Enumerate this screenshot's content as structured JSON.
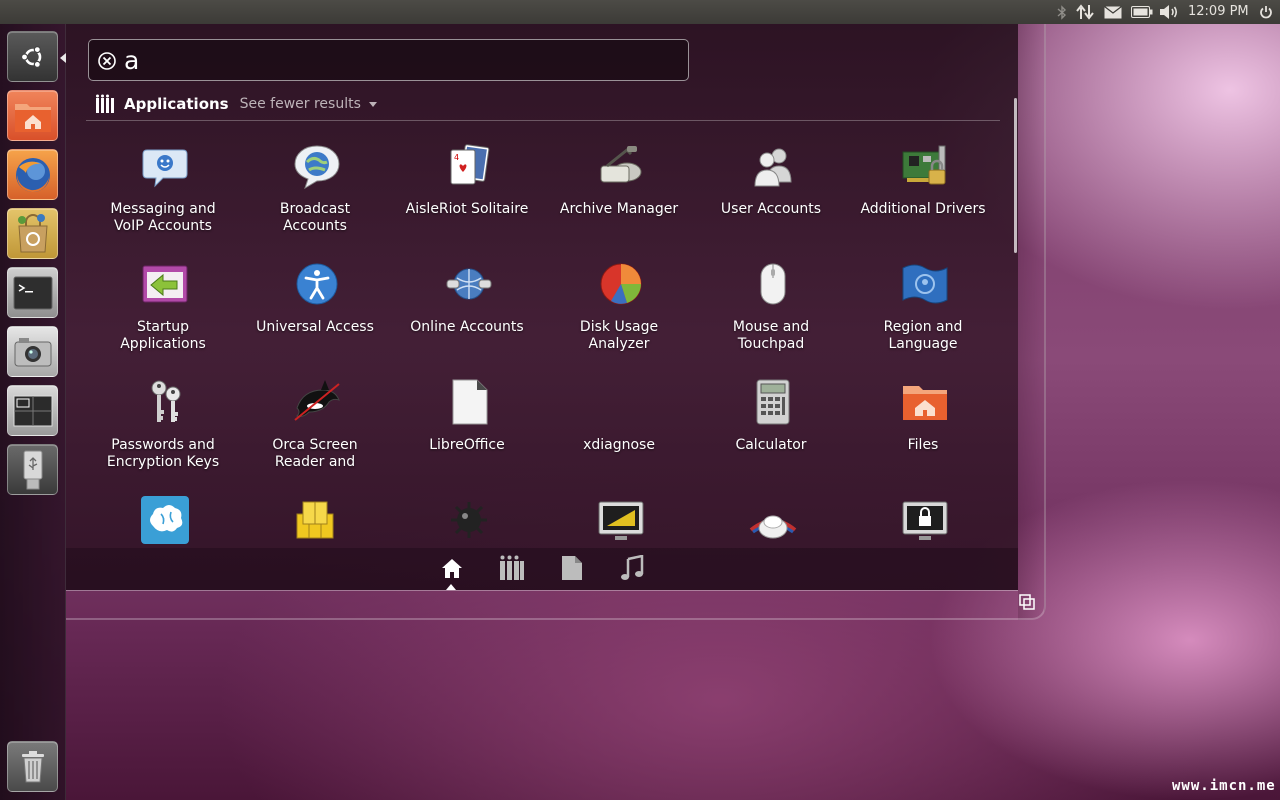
{
  "top_panel": {
    "clock": "12:09 PM",
    "indicators": [
      "bluetooth-icon",
      "network-icon",
      "mail-icon",
      "battery-icon",
      "volume-icon",
      "power-icon"
    ]
  },
  "launcher": {
    "items": [
      "dash-home",
      "home-folder",
      "firefox",
      "ubuntu-software-center",
      "terminal",
      "shotwell",
      "workspace-switcher",
      "usb-drive",
      "trash"
    ]
  },
  "search": {
    "query": "a",
    "placeholder": ""
  },
  "category": {
    "title": "Applications",
    "see_fewer": "See fewer results"
  },
  "results": [
    {
      "label": "Messaging and\nVoIP Accounts",
      "icon": "messaging-icon"
    },
    {
      "label": "Broadcast\nAccounts",
      "icon": "broadcast-icon"
    },
    {
      "label": "AisleRiot Solitaire",
      "icon": "cards-icon"
    },
    {
      "label": "Archive Manager",
      "icon": "archive-icon"
    },
    {
      "label": "User Accounts",
      "icon": "users-icon"
    },
    {
      "label": "Additional Drivers",
      "icon": "drivers-icon"
    },
    {
      "label": "Startup\nApplications",
      "icon": "startup-icon"
    },
    {
      "label": "Universal Access",
      "icon": "accessibility-icon"
    },
    {
      "label": "Online Accounts",
      "icon": "online-accounts-icon"
    },
    {
      "label": "Disk Usage\nAnalyzer",
      "icon": "disk-usage-icon"
    },
    {
      "label": "Mouse and\nTouchpad",
      "icon": "mouse-icon"
    },
    {
      "label": "Region and\nLanguage",
      "icon": "region-icon"
    },
    {
      "label": "Passwords and\nEncryption Keys",
      "icon": "keys-icon"
    },
    {
      "label": "Orca Screen\nReader and",
      "icon": "orca-icon"
    },
    {
      "label": "LibreOffice",
      "icon": "libreoffice-icon"
    },
    {
      "label": "xdiagnose",
      "icon": "xdiagnose-icon"
    },
    {
      "label": "Calculator",
      "icon": "calculator-icon"
    },
    {
      "label": "Files",
      "icon": "files-icon"
    },
    {
      "label": "",
      "icon": "brain-icon"
    },
    {
      "label": "",
      "icon": "mahjongg-icon"
    },
    {
      "label": "",
      "icon": "mines-icon"
    },
    {
      "label": "",
      "icon": "display-icon"
    },
    {
      "label": "",
      "icon": "disc-icon"
    },
    {
      "label": "",
      "icon": "lock-screen-icon"
    }
  ],
  "lenses": [
    "home-lens-icon",
    "applications-lens-icon",
    "files-lens-icon",
    "music-lens-icon"
  ],
  "watermark": "www.imcn.me",
  "colors": {
    "panel": "#3c3b37",
    "accent_orange": "#e95420",
    "dash_bg": "#2c1222"
  }
}
